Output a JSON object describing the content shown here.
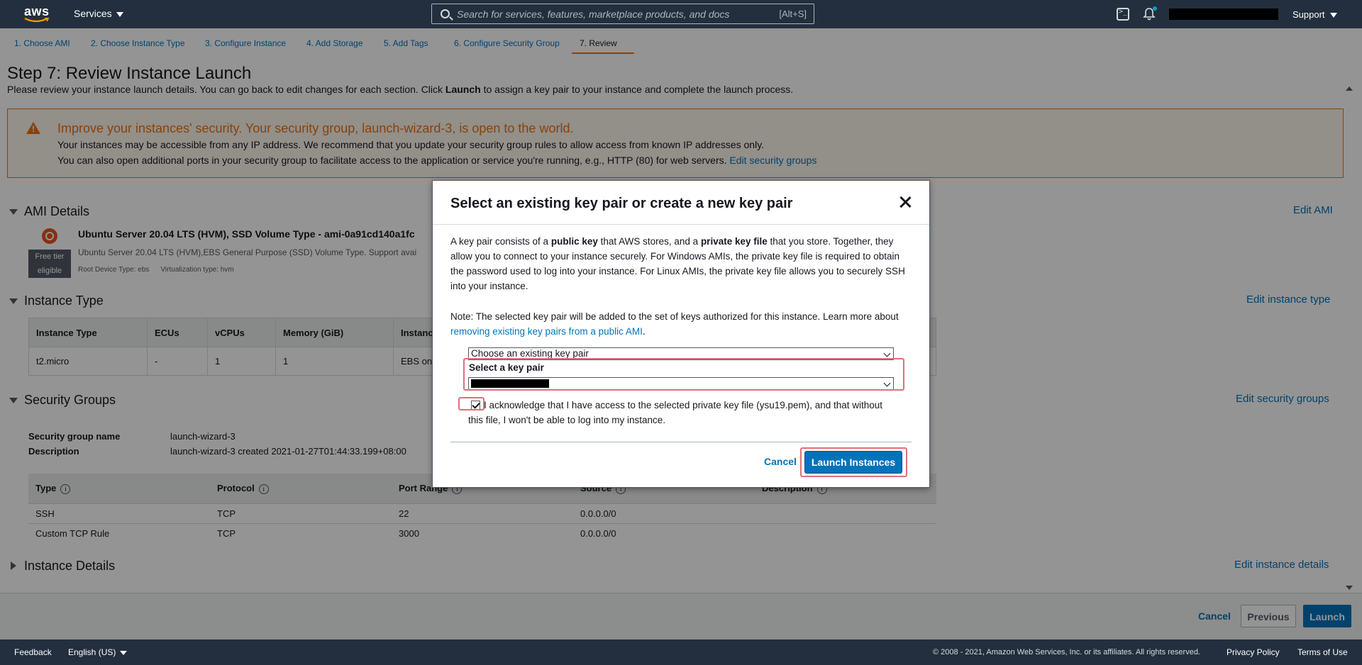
{
  "topnav": {
    "logo_text": "aws",
    "services_label": "Services",
    "search_placeholder": "Search for services, features, marketplace products, and docs",
    "search_shortcut": "[Alt+S]",
    "support_label": "Support"
  },
  "steps": [
    {
      "label": "1. Choose AMI"
    },
    {
      "label": "2. Choose Instance Type"
    },
    {
      "label": "3. Configure Instance"
    },
    {
      "label": "4. Add Storage"
    },
    {
      "label": "5. Add Tags"
    },
    {
      "label": "6. Configure Security Group"
    },
    {
      "label": "7. Review"
    }
  ],
  "page": {
    "title": "Step 7: Review Instance Launch",
    "desc_before": "Please review your instance launch details. You can go back to edit changes for each section. Click ",
    "desc_bold": "Launch",
    "desc_after": " to assign a key pair to your instance and complete the launch process."
  },
  "warning": {
    "title": "Improve your instances' security. Your security group, launch-wizard-3, is open to the world.",
    "line1": "Your instances may be accessible from any IP address. We recommend that you update your security group rules to allow access from known IP addresses only.",
    "line2": "You can also open additional ports in your security group to facilitate access to the application or service you're running, e.g., HTTP (80) for web servers.",
    "link": "Edit security groups"
  },
  "ami": {
    "section_title": "AMI Details",
    "edit_label": "Edit AMI",
    "name": "Ubuntu Server 20.04 LTS (HVM), SSD Volume Type - ami-0a91cd140a1fc",
    "desc": "Ubuntu Server 20.04 LTS (HVM),EBS General Purpose (SSD) Volume Type. Support avai",
    "root_device": "Root Device Type: ebs",
    "virtualization": "Virtualization type: hvm",
    "free_tier_line1": "Free tier",
    "free_tier_line2": "eligible"
  },
  "instance_type": {
    "section_title": "Instance Type",
    "edit_label": "Edit instance type",
    "columns": [
      "Instance Type",
      "ECUs",
      "vCPUs",
      "Memory (GiB)",
      "Instanc"
    ],
    "row": [
      "t2.micro",
      "-",
      "1",
      "1",
      "EBS on"
    ]
  },
  "security_groups": {
    "section_title": "Security Groups",
    "edit_label": "Edit security groups",
    "name_label": "Security group name",
    "name_value": "launch-wizard-3",
    "desc_label": "Description",
    "desc_value": "launch-wizard-3 created 2021-01-27T01:44:33.199+08:00",
    "columns": [
      "Type",
      "Protocol",
      "Port Range",
      "Source",
      "Description"
    ],
    "rows": [
      [
        "SSH",
        "TCP",
        "22",
        "0.0.0.0/0",
        ""
      ],
      [
        "Custom TCP Rule",
        "TCP",
        "3000",
        "0.0.0.0/0",
        ""
      ]
    ]
  },
  "instance_details": {
    "section_title": "Instance Details",
    "edit_label": "Edit instance details"
  },
  "bottom": {
    "cancel": "Cancel",
    "previous": "Previous",
    "launch": "Launch"
  },
  "footer": {
    "feedback": "Feedback",
    "language": "English (US)",
    "copyright": "© 2008 - 2021, Amazon Web Services, Inc. or its affiliates. All rights reserved.",
    "privacy": "Privacy Policy",
    "terms": "Terms of Use"
  },
  "modal": {
    "title": "Select an existing key pair or create a new key pair",
    "p1_a": "A key pair consists of a ",
    "p1_b": "public key",
    "p1_c": " that AWS stores, and a ",
    "p1_d": "private key file",
    "p1_e": " that you store. Together, they allow you to connect to your instance securely. For Windows AMIs, the private key file is required to obtain the password used to log into your instance. For Linux AMIs, the private key file allows you to securely SSH into your instance.",
    "note": "Note: The selected key pair will be added to the set of keys authorized for this instance. Learn more about ",
    "note_link": "removing existing key pairs from a public AMI",
    "note_end": ".",
    "option_select": "Choose an existing key pair",
    "key_label": "Select a key pair",
    "ack": "I acknowledge that I have access to the selected private key file (ysu19.pem), and that without this file, I won't be able to log into my instance.",
    "cancel": "Cancel",
    "launch": "Launch Instances"
  }
}
